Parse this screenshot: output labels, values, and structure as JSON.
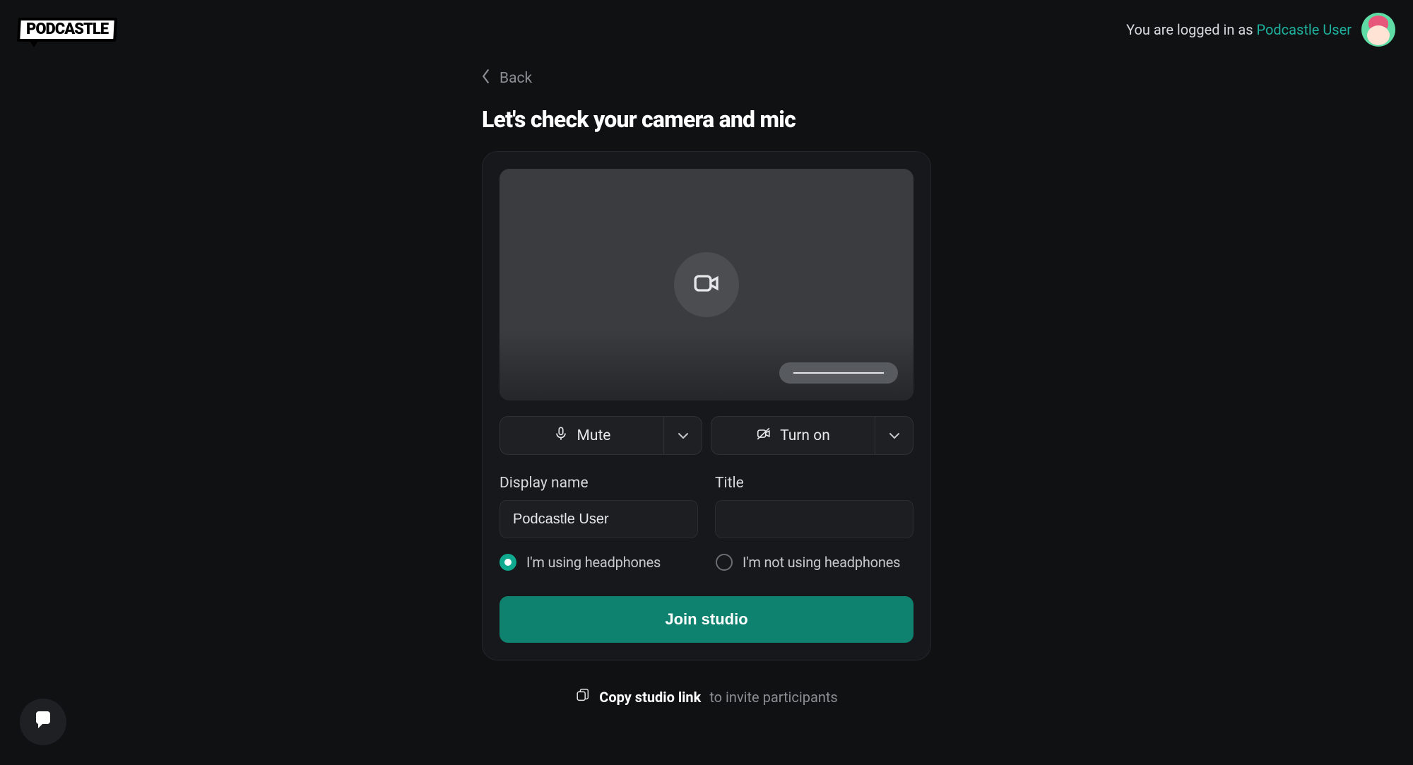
{
  "logo": {
    "text": "PODCASTLE"
  },
  "header": {
    "prefix": "You are logged in as ",
    "username": "Podcastle User"
  },
  "nav": {
    "back": "Back"
  },
  "headline": "Let's check your camera and mic",
  "controls": {
    "mute": "Mute",
    "turn_on": "Turn on"
  },
  "fields": {
    "display_name_label": "Display name",
    "display_name_value": "Podcastle User",
    "title_label": "Title",
    "title_value": ""
  },
  "radios": {
    "using": "I'm using headphones",
    "not_using": "I'm not using headphones",
    "selected": "using"
  },
  "cta": {
    "join": "Join studio"
  },
  "copy": {
    "label": "Copy studio link",
    "hint": "to invite participants"
  },
  "colors": {
    "accent": "#0fa98f",
    "accent_dark": "#0e826f"
  }
}
